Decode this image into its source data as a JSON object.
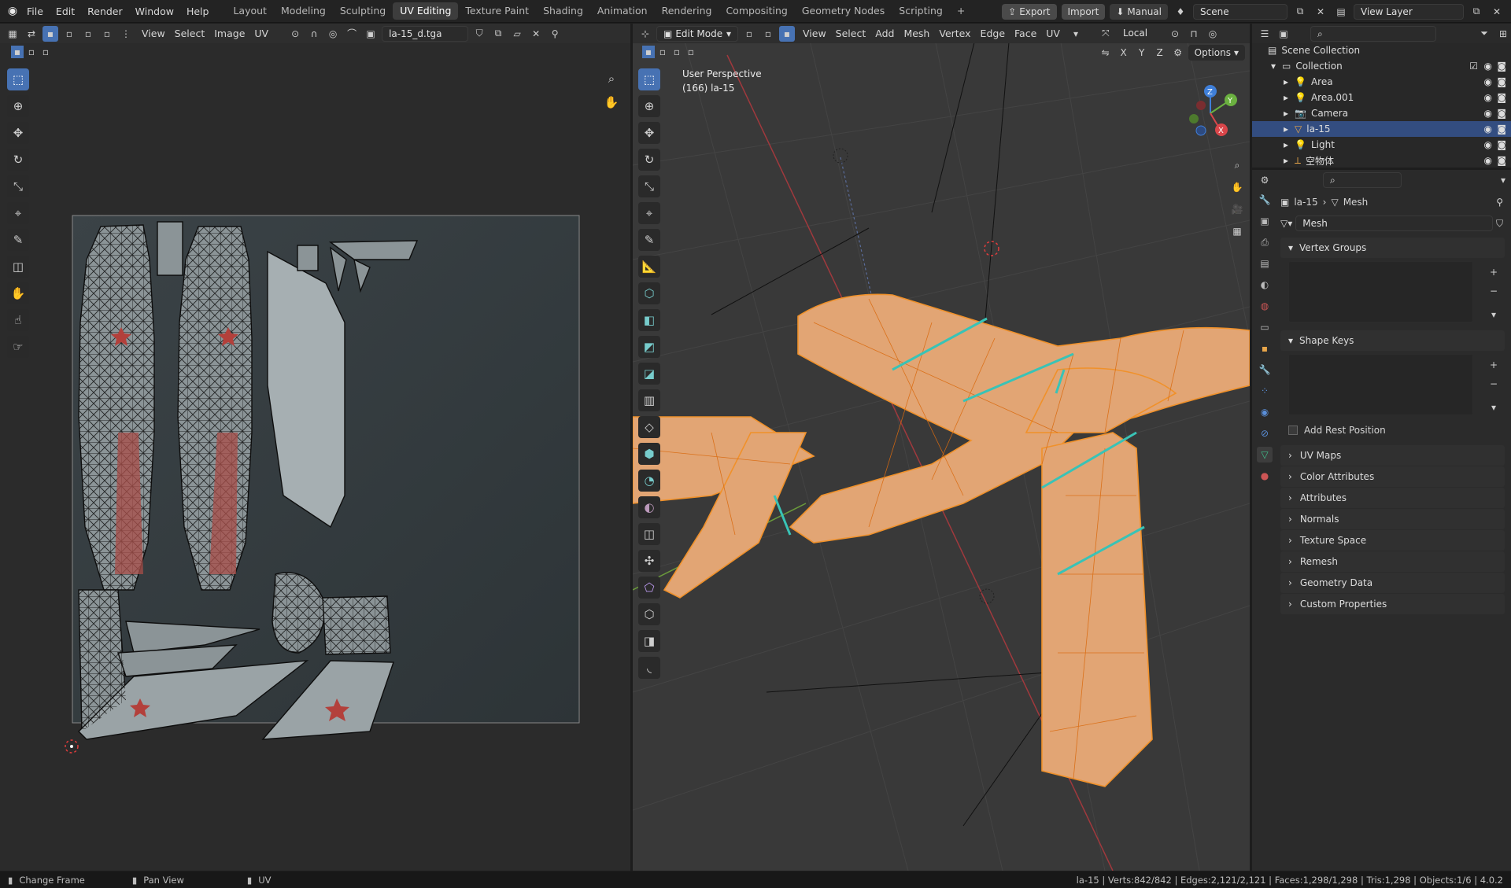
{
  "topmenu": {
    "items": [
      "File",
      "Edit",
      "Render",
      "Window",
      "Help"
    ]
  },
  "workspaces": {
    "tabs": [
      "Layout",
      "Modeling",
      "Sculpting",
      "UV Editing",
      "Texture Paint",
      "Shading",
      "Animation",
      "Rendering",
      "Compositing",
      "Geometry Nodes",
      "Scripting"
    ],
    "active": "UV Editing",
    "add": "+"
  },
  "top_right": {
    "export": "Export",
    "import": "Import",
    "manual": "Manual",
    "scene": "Scene",
    "view_layer": "View Layer"
  },
  "uv_editor": {
    "menus": [
      "View",
      "Select",
      "Image",
      "UV"
    ],
    "image_name": "la-15_d.tga"
  },
  "viewport": {
    "mode": "Edit Mode",
    "menus": [
      "View",
      "Select",
      "Add",
      "Mesh",
      "Vertex",
      "Edge",
      "Face",
      "UV"
    ],
    "pivot": "Local",
    "perspective": "User Perspective",
    "object_label": "(166) la-15",
    "axes": [
      "X",
      "Y",
      "Z"
    ],
    "options": "Options",
    "gizmo": {
      "z": "Z",
      "y": "Y",
      "x": "X"
    }
  },
  "outliner": {
    "root": "Scene Collection",
    "collection": "Collection",
    "items": [
      {
        "name": "Area",
        "selected": false
      },
      {
        "name": "Area.001",
        "selected": false
      },
      {
        "name": "Camera",
        "selected": false
      },
      {
        "name": "la-15",
        "selected": true
      },
      {
        "name": "Light",
        "selected": false
      },
      {
        "name": "空物体",
        "selected": false
      }
    ]
  },
  "properties": {
    "breadcrumb_obj": "la-15",
    "breadcrumb_data": "Mesh",
    "datablock": "Mesh",
    "vertex_groups": "Vertex Groups",
    "shape_keys": "Shape Keys",
    "add_rest_position": "Add Rest Position",
    "sections": [
      "UV Maps",
      "Color Attributes",
      "Attributes",
      "Normals",
      "Texture Space",
      "Remesh",
      "Geometry Data",
      "Custom Properties"
    ]
  },
  "statusbar": {
    "left": [
      "Change Frame",
      "Pan View",
      "UV"
    ],
    "stats": "la-15 | Verts:842/842 | Edges:2,121/2,121 | Faces:1,298/1,298 | Tris:1,298 | Objects:1/6 | 4.0.2"
  },
  "colors": {
    "accent": "#4772b3",
    "mesh": "#e2a574",
    "edge": "#f0912a",
    "seam": "#39c3b6"
  }
}
